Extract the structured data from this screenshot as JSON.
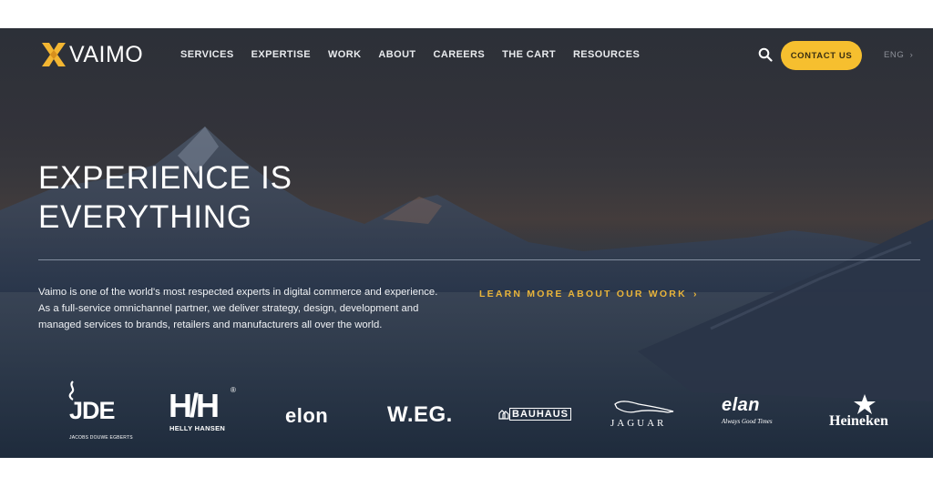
{
  "header": {
    "logo_text": "VAIMO",
    "nav_items": [
      "SERVICES",
      "EXPERTISE",
      "WORK",
      "ABOUT",
      "CAREERS",
      "THE CART",
      "RESOURCES"
    ],
    "search_icon": "search-icon",
    "contact_label": "CONTACT US",
    "language_label": "ENG",
    "language_chevron": "›"
  },
  "hero": {
    "headline_line1": "EXPERIENCE IS",
    "headline_line2": "EVERYTHING",
    "description": "Vaimo is one of the world's most respected experts in digital commerce and experience. As a full-service omnichannel partner, we deliver strategy, design, development and managed services to brands, retailers and manufacturers all over the world.",
    "cta_label": "LEARN MORE ABOUT OUR WORK",
    "cta_chevron": "›"
  },
  "brands": [
    {
      "name": "JDE",
      "sub": "JACOBS DOUWE EGBERTS"
    },
    {
      "name": "HH",
      "sub": "HELLY HANSEN"
    },
    {
      "name": "elon",
      "sub": ""
    },
    {
      "name": "W.EG.",
      "sub": ""
    },
    {
      "name": "BAUHAUS",
      "sub": ""
    },
    {
      "name": "JAGUAR",
      "sub": ""
    },
    {
      "name": "elan",
      "sub": "Always Good Times"
    },
    {
      "name": "Heineken",
      "sub": ""
    }
  ],
  "colors": {
    "accent": "#f6bf2f",
    "cta_text": "#e9b43a",
    "hero_bg": "#2c3038"
  }
}
